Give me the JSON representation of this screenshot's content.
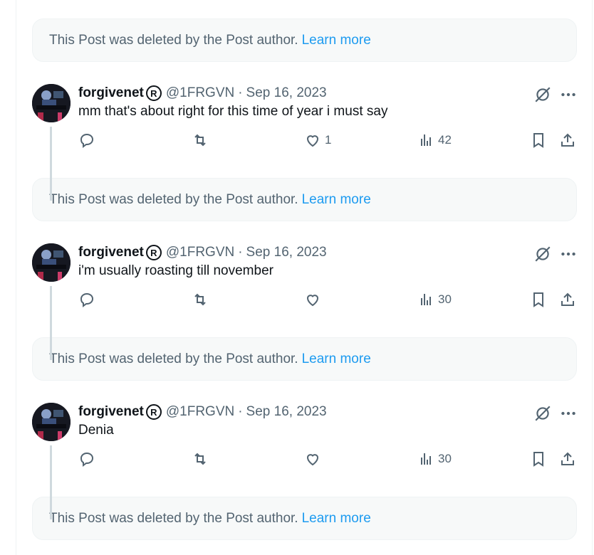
{
  "deleted_notice": {
    "text": "This Post was deleted by the Post author.",
    "link": "Learn more"
  },
  "colors": {
    "link": "#1d9bf0",
    "secondary": "#536471",
    "card_bg": "#f7f9f9",
    "thread_line": "#cfd9de"
  },
  "icons": {
    "reply": "reply-icon",
    "repost": "repost-icon",
    "like": "heart-icon",
    "views": "views-chart-icon",
    "bookmark": "bookmark-icon",
    "share": "share-icon",
    "grok": "grok-icon",
    "more": "more-icon"
  },
  "posts": [
    {
      "display_name": "forgivenet",
      "badge": "R",
      "handle": "@1FRGVN",
      "separator": "·",
      "date": "Sep 16, 2023",
      "text": "mm that's about right for this time of year i must say",
      "likes": "1",
      "views": "42"
    },
    {
      "display_name": "forgivenet",
      "badge": "R",
      "handle": "@1FRGVN",
      "separator": "·",
      "date": "Sep 16, 2023",
      "text": "i'm usually roasting till november",
      "likes": "",
      "views": "30"
    },
    {
      "display_name": "forgivenet",
      "badge": "R",
      "handle": "@1FRGVN",
      "separator": "·",
      "date": "Sep 16, 2023",
      "text": "Denia",
      "likes": "",
      "views": "30"
    }
  ]
}
